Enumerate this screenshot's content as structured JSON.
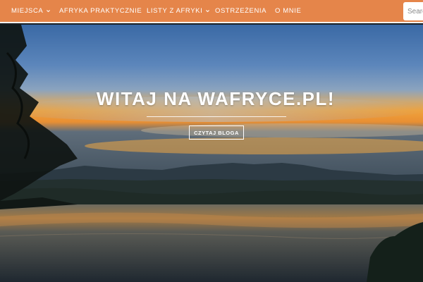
{
  "nav": {
    "items": [
      {
        "label": "MIEJSCA",
        "has_dropdown": true,
        "icon": "chevron-down-icon"
      },
      {
        "label": "AFRYKA PRAKTYCZNIE",
        "has_dropdown": false
      },
      {
        "label": "LISTY Z AFRYKI",
        "has_dropdown": true,
        "icon": "chevron-down-icon"
      },
      {
        "label": "OSTRZEŻENIA",
        "has_dropdown": false
      },
      {
        "label": "O MNIE",
        "has_dropdown": false
      }
    ],
    "search": {
      "placeholder": "Search",
      "value": ""
    },
    "background_color": "#e5854a"
  },
  "hero": {
    "title": "WITAJ NA WAFRYCE.PL!",
    "button_label": "CZYTAJ BLOGA",
    "image": "sunset-over-lake-landscape",
    "colors": {
      "sky_top": "#3f6fa8",
      "sunset": "#f0a23a",
      "water": "#2e3a40"
    }
  }
}
